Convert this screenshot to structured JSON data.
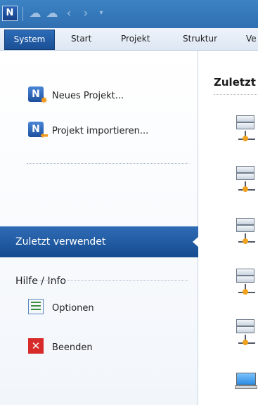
{
  "window": {
    "app_icon_letter": "N"
  },
  "ribbon": {
    "tabs": [
      "System",
      "Start",
      "Projekt",
      "Struktur",
      "Ve"
    ]
  },
  "backstage": {
    "commands": [
      {
        "label": "Neues Projekt...",
        "icon": "new-project-icon"
      },
      {
        "label": "Projekt importieren...",
        "icon": "import-project-icon"
      }
    ],
    "nav": {
      "selected": "Zuletzt verwendet",
      "items": [
        "Hilfe / Info"
      ]
    },
    "bottom_commands": [
      {
        "label": "Optionen",
        "icon": "options-icon"
      },
      {
        "label": "Beenden",
        "icon": "exit-icon"
      }
    ]
  },
  "recent": {
    "title": "Zuletzt"
  },
  "colors": {
    "accent": "#1f5aa3",
    "tab_active": "#1a4f95",
    "exit_red": "#d72b2b"
  }
}
